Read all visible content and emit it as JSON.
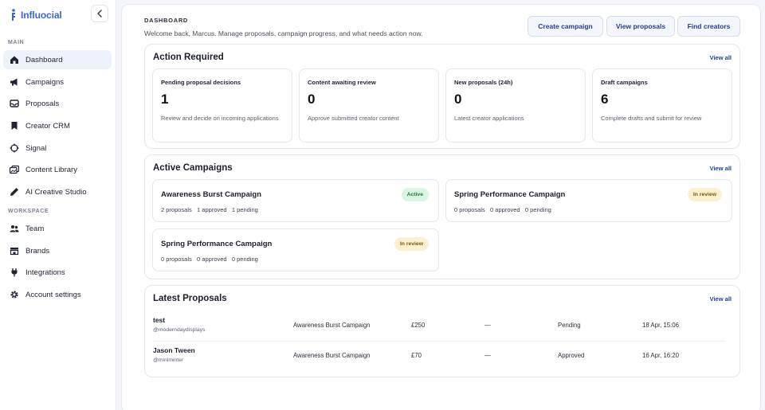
{
  "brand": {
    "name": "Influocial",
    "color": "#3d63d9"
  },
  "sidebar": {
    "sections": {
      "main": "MAIN",
      "workspace": "WORKSPACE"
    },
    "main_items": [
      {
        "label": "Dashboard",
        "icon": "home-icon",
        "active": true
      },
      {
        "label": "Campaigns",
        "icon": "megaphone-icon"
      },
      {
        "label": "Proposals",
        "icon": "inbox-icon"
      },
      {
        "label": "Creator CRM",
        "icon": "bookmark-icon"
      },
      {
        "label": "Signal",
        "icon": "crosshair-icon"
      },
      {
        "label": "Content Library",
        "icon": "images-icon"
      },
      {
        "label": "AI Creative Studio",
        "icon": "pen-icon"
      }
    ],
    "workspace_items": [
      {
        "label": "Team",
        "icon": "users-icon"
      },
      {
        "label": "Brands",
        "icon": "store-icon"
      },
      {
        "label": "Integrations",
        "icon": "plug-icon"
      },
      {
        "label": "Account settings",
        "icon": "gear-icon"
      }
    ]
  },
  "header": {
    "title": "DASHBOARD",
    "subtitle": "Welcome back, Marcus. Manage proposals, campaign progress, and what needs action now.",
    "buttons": {
      "create": "Create campaign",
      "view": "View proposals",
      "find": "Find creators"
    }
  },
  "action_required": {
    "title": "Action Required",
    "view_all": "View all",
    "stats": [
      {
        "label": "Pending proposal decisions",
        "value": "1",
        "desc": "Review and decide on incoming applications"
      },
      {
        "label": "Content awaiting review",
        "value": "0",
        "desc": "Approve submitted creator content"
      },
      {
        "label": "New proposals (24h)",
        "value": "0",
        "desc": "Latest creator applications"
      },
      {
        "label": "Draft campaigns",
        "value": "6",
        "desc": "Complete drafts and submit for review"
      }
    ]
  },
  "active_campaigns": {
    "title": "Active Campaigns",
    "view_all": "View all",
    "items": [
      {
        "name": "Awareness Burst Campaign",
        "status": "Active",
        "proposals": "2 proposals",
        "approved": "1 approved",
        "pending": "1 pending"
      },
      {
        "name": "Spring Performance Campaign",
        "status": "In review",
        "proposals": "0 proposals",
        "approved": "0 approved",
        "pending": "0 pending"
      },
      {
        "name": "Spring Performance Campaign",
        "status": "In review",
        "proposals": "0 proposals",
        "approved": "0 approved",
        "pending": "0 pending"
      }
    ]
  },
  "latest_proposals": {
    "title": "Latest Proposals",
    "view_all": "View all",
    "rows": [
      {
        "name": "test",
        "handle": "@moderndaydisplays",
        "campaign": "Awareness Burst Campaign",
        "amount": "£250",
        "extra": "—",
        "status": "Pending",
        "date": "18 Apr, 15:06"
      },
      {
        "name": "Jason Tween",
        "handle": "@miniminter",
        "campaign": "Awareness Burst Campaign",
        "amount": "£70",
        "extra": "—",
        "status": "Approved",
        "date": "16 Apr, 16:20"
      }
    ]
  }
}
